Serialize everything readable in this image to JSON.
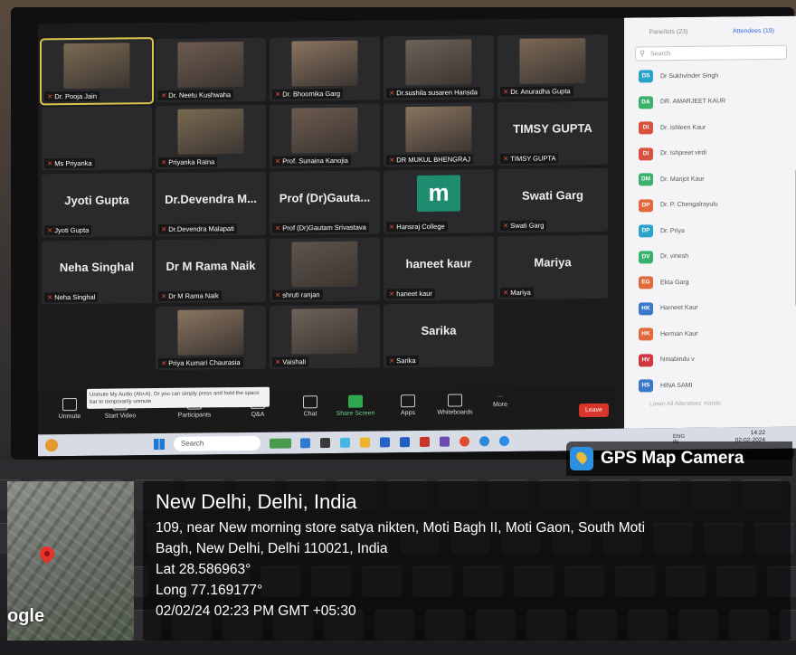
{
  "meeting": {
    "tiles": [
      {
        "label": "Dr. Pooja Jain",
        "type": "video",
        "highlight": true
      },
      {
        "label": "Dr. Neetu Kushwaha",
        "type": "video"
      },
      {
        "label": "Dr. Bhoomika Garg",
        "type": "video"
      },
      {
        "label": "Dr.sushila susaren Hansda",
        "type": "video"
      },
      {
        "label": "Dr. Anuradha Gupta",
        "type": "video"
      },
      {
        "label": "Ms Priyanka",
        "type": "name"
      },
      {
        "label": "Priyanka Raina",
        "type": "video"
      },
      {
        "label": "Prof. Sunaina Kanojia",
        "type": "video"
      },
      {
        "label": "DR MUKUL BHENGRAJ",
        "type": "video"
      },
      {
        "label": "TIMSY GUPTA",
        "big": "TIMSY GUPTA",
        "type": "name"
      },
      {
        "label": "Jyoti Gupta",
        "big": "Jyoti Gupta",
        "type": "name"
      },
      {
        "label": "Dr.Devendra Malapati",
        "big": "Dr.Devendra M...",
        "type": "name"
      },
      {
        "label": "Prof (Dr)Gautam Srivastava",
        "big": "Prof (Dr)Gauta...",
        "type": "name"
      },
      {
        "label": "Hansraj College",
        "big": "m",
        "type": "logo"
      },
      {
        "label": "Swati Garg",
        "big": "Swati Garg",
        "type": "name"
      },
      {
        "label": "Neha Singhal",
        "big": "Neha Singhal",
        "type": "name"
      },
      {
        "label": "Dr M Rama Naik",
        "big": "Dr M Rama Naik",
        "type": "name"
      },
      {
        "label": "shruti ranjan",
        "type": "video"
      },
      {
        "label": "haneet kaur",
        "big": "haneet kaur",
        "type": "name"
      },
      {
        "label": "Mariya",
        "big": "Mariya",
        "type": "name"
      },
      {
        "label": "Priya Kumari Chaurasia",
        "type": "video"
      },
      {
        "label": "Vaishali",
        "type": "video"
      },
      {
        "label": "Sarika",
        "big": "Sarika",
        "type": "name"
      }
    ],
    "toolbar": {
      "unmute": "Unmute",
      "start_video": "Start Video",
      "participants": "Participants",
      "qa": "Q&A",
      "chat": "Chat",
      "share": "Share Screen",
      "apps": "Apps",
      "whiteboards": "Whiteboards",
      "more": "More",
      "leave": "Leave",
      "tooltip": "Unmute My Audio (Alt+A). Or you can simply press and hold the space bar to temporarily unmute"
    },
    "panel": {
      "tab_panelists": "Panelists (23)",
      "tab_attendees": "Attendees (19)",
      "search_placeholder": "Search",
      "lower_hands": "Lower All Attendees' Hands",
      "attendees": [
        {
          "initials": "DS",
          "name": "Dr Sukhvinder Singh",
          "color": "#2aa3c9"
        },
        {
          "initials": "DA",
          "name": "DR. AMARJEET KAUR",
          "color": "#3ab16b"
        },
        {
          "initials": "DI",
          "name": "Dr. Ishleen Kaur",
          "color": "#d8503e"
        },
        {
          "initials": "DI",
          "name": "Dr. Ishpreet virdi",
          "color": "#d8503e"
        },
        {
          "initials": "DM",
          "name": "Dr. Manjot Kaur",
          "color": "#3ab16b"
        },
        {
          "initials": "DP",
          "name": "Dr. P. Chengalrayulu",
          "color": "#e2693b"
        },
        {
          "initials": "DP",
          "name": "Dr. Priya",
          "color": "#2aa3c9"
        },
        {
          "initials": "DV",
          "name": "Dr. vinesh",
          "color": "#3ab16b"
        },
        {
          "initials": "EG",
          "name": "Ekta Garg",
          "color": "#e2693b"
        },
        {
          "initials": "HK",
          "name": "Harneet Kaur",
          "color": "#3b78c9"
        },
        {
          "initials": "HK",
          "name": "Herman Kaur",
          "color": "#e2693b"
        },
        {
          "initials": "HV",
          "name": "himabindu v",
          "color": "#d0363f"
        },
        {
          "initials": "HS",
          "name": "HINA SAMI",
          "color": "#3b78c9"
        }
      ]
    },
    "taskbar": {
      "search": "Search",
      "lang": "ENG IN",
      "time": "14:22",
      "date": "02-02-2024"
    }
  },
  "gps": {
    "brand": "GPS Map Camera",
    "city": "New Delhi, Delhi, India",
    "address_line1": "109, near New morning store satya nikten, Moti Bagh II, Moti Gaon, South Moti",
    "address_line2": "Bagh, New Delhi, Delhi 110021, India",
    "lat": "Lat 28.586963°",
    "long": "Long 77.169177°",
    "datetime": "02/02/24 02:23 PM GMT +05:30",
    "map_label": "ogle"
  }
}
